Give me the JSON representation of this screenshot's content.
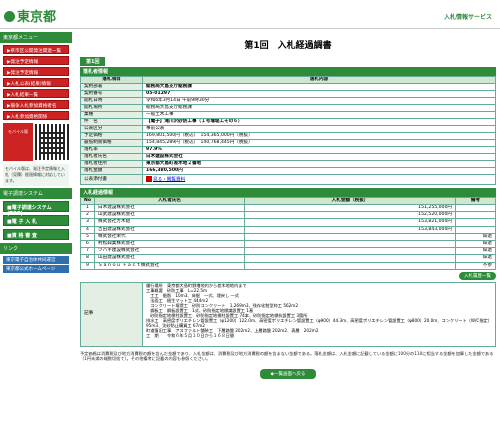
{
  "header": {
    "logo": "東京都",
    "right": "入札情報サービス"
  },
  "sidebar": {
    "title1": "東京都メニュー",
    "menu": [
      "▶県市区公開発注関連一覧",
      "▶発注予定情報",
      "▶発注予定情報",
      "▶入札公表(結果)情報",
      "▶入札結果一覧",
      "▶競争入札参加資格者名",
      "▶入札参加資格関係"
    ],
    "mobile_label": "モバイル版",
    "text": "モバイル版は、発注予定情報と入札（見積）経過情報に対応しています。",
    "title2": "電子調達システム",
    "buttons": [
      "■電子調達システム(TOP)",
      "■電 子 入 札",
      "■資 格 審 査"
    ],
    "title3": "リンク",
    "links": [
      "東京電子自治体共同運営",
      "東京都公式ホームページ"
    ]
  },
  "main": {
    "title": "第1回　入札経過調書",
    "tab": "第1回",
    "sec1": "落札者情報",
    "h_item": "落札項目",
    "h_content": "落札内容",
    "rows": [
      [
        "契約部署",
        "総務局大島支庁総務課"
      ],
      [
        "契約番号",
        "05-01297"
      ],
      [
        "開札日時",
        "令和6年3月14日 午前9時30分"
      ],
      [
        "開札場所",
        "総務局大島支庁総務課"
      ],
      [
        "業種",
        "一般土木工事"
      ],
      [
        "件　名",
        "【電子】滝川沢砂防工事（１号堰堤工その６）"
      ],
      [
        "公表区分",
        "事前公表"
      ],
      [
        "予定価格",
        "169,801,500円（税込）　154,365,000円（税抜）"
      ],
      [
        "最低制限価格",
        "154,845,289円（税込）　140,768,445円（税抜）"
      ],
      [
        "落札率",
        "97.9%"
      ],
      [
        "落札者氏名",
        "白木建設株式会社"
      ],
      [
        "落札者住所",
        "東京都大島町差木地２番地"
      ],
      [
        "落札金額",
        "166,380,500円"
      ]
    ],
    "pub_label": "公表添付書",
    "pub_link": "見る・閲覧資料",
    "sec2": "入札経過情報",
    "bid_headers": [
      "No",
      "入札者氏名",
      "入札金額（税抜）",
      "備考"
    ],
    "bids": [
      [
        "1",
        "白木建設株式会社",
        "151,255,000円",
        ""
      ],
      [
        "2",
        "山武建設株式会社",
        "152,520,000円",
        ""
      ],
      [
        "3",
        "株式会社芳木組",
        "153,821,000円",
        ""
      ],
      [
        "4",
        "吉田建設株式会社",
        "153,843,000円",
        ""
      ],
      [
        "5",
        "株式会社栄代",
        "",
        "辞退"
      ],
      [
        "6",
        "村松興業株式会社",
        "",
        "辞退"
      ],
      [
        "7",
        "ツバキ建設株式会社",
        "",
        "辞退"
      ],
      [
        "8",
        "山田建設株式会社",
        "",
        "辞退"
      ],
      [
        "9",
        "Ｓａｎｏｕ Ｆａｃｔ株式会社",
        "",
        "不参"
      ]
    ],
    "bid_btn": "入札履歴一覧",
    "notes_label": "記事",
    "notes": "履行場所　東京都大島町野増地内から差木地地内まで\n工事概要　砂防工事　L=22.5m\n　工工　掘削　10m3、床掘　一式、埋戻し 一式\n　法面工　植生マット工 444m2\n　コンクリート堰堤工　砂防コンクリート　1,269m3、残存化粧型枠工 562m2\n　鋼板工　鋼板設置工　1式、砂防指定地標識設置工 1基\n　砂防指定地標柱設置工　砂防指定地標柱設置工 74本、砂防指定地標杭設置工 3箇所\n排水工　高密度ポリエチレン管設置工（φ1200）122.0m、高密度ポリエチレン管設置工（φ900）44.3m、高密度ポリエチレン管設置工（φ800）20.0m、コンクリート（W/C指定）95m3、沈砂防止購買工 67m2\n町道復旧工事　アスファルト舗装工　下層路盤 202m2、上層路盤 202m2、表層　202m2\n工　期　　令和６年５月１０日から１６８日間",
    "footer": "予定価格は消費税及び地方消費税の額を含んだ金額であり、入札金額は、消費税及び地方消費税の額を含まない金額である。落札金額は、入札金額に記載している金額に100分の110に相当する金額を加算した金額である（1円未満の端数切捨て）。その他備考に記載の内容も参照ください。",
    "back": "◆一覧画面へ戻る"
  }
}
